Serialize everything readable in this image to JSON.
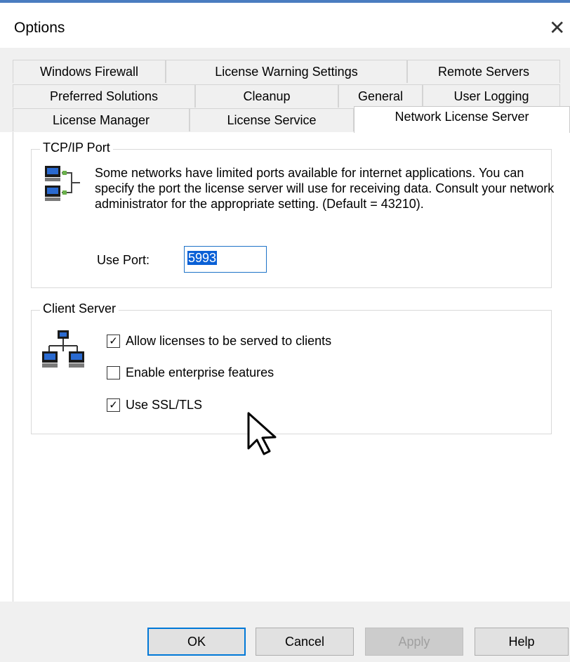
{
  "window": {
    "title": "Options",
    "close_glyph": "✕"
  },
  "tabs": {
    "row1": [
      "Windows Firewall",
      "License Warning Settings",
      "Remote Servers"
    ],
    "row2": [
      "Preferred Solutions",
      "Cleanup",
      "General",
      "User Logging"
    ],
    "row3": [
      "License Manager",
      "License Service",
      "Network License Server"
    ],
    "selected": "Network License Server"
  },
  "tcpip": {
    "legend": "TCP/IP Port",
    "description": "Some networks have limited ports available for internet applications.  You can specify the port the license server will use for receiving data.  Consult your network administrator for the appropriate setting. (Default = 43210).",
    "port_label": "Use Port:",
    "port_value": "5993",
    "icon": "network-computers-icon"
  },
  "client_server": {
    "legend": "Client Server",
    "icon": "network-hierarchy-icon",
    "options": [
      {
        "label": "Allow licenses to be served to clients",
        "checked": true
      },
      {
        "label": "Enable enterprise features",
        "checked": false
      },
      {
        "label": "Use SSL/TLS",
        "checked": true
      }
    ]
  },
  "buttons": {
    "ok": "OK",
    "cancel": "Cancel",
    "apply": "Apply",
    "help": "Help"
  },
  "colors": {
    "accent": "#0078d7",
    "selection": "#0a60d6"
  }
}
